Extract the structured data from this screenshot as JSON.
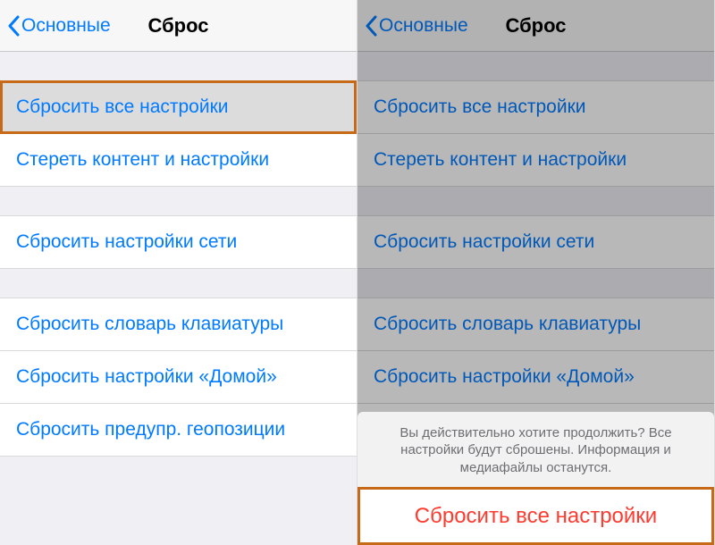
{
  "header": {
    "back_label": "Основные",
    "title": "Сброс"
  },
  "group1": {
    "item0": "Сбросить все настройки",
    "item1": "Стереть контент и настройки"
  },
  "group2": {
    "item0": "Сбросить настройки сети"
  },
  "group3": {
    "item0": "Сбросить словарь клавиатуры",
    "item1": "Сбросить настройки «Домой»",
    "item2": "Сбросить предупр. геопозиции"
  },
  "sheet": {
    "message": "Вы действительно хотите продолжить? Все настройки будут сброшены. Информация и медиафайлы останутся.",
    "confirm_label": "Сбросить все настройки"
  }
}
